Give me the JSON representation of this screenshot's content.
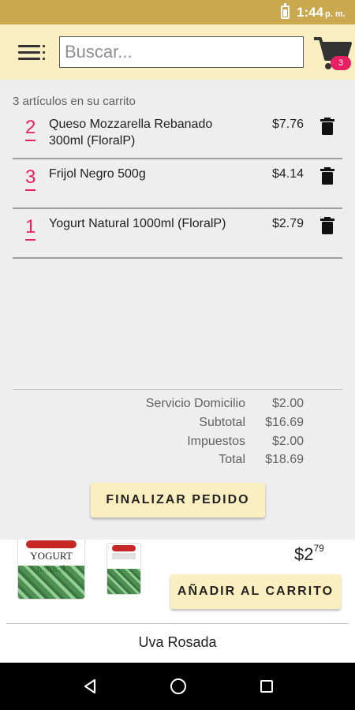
{
  "status_bar": {
    "time": "1:44",
    "ampm": "p. m."
  },
  "header": {
    "search_placeholder": "Buscar...",
    "cart_badge": "3"
  },
  "cart": {
    "count_text": "3 artículos en su carrito",
    "items": [
      {
        "qty": "2",
        "name": "Queso Mozzarella Rebanado 300ml (FloralP)",
        "price": "$7.76"
      },
      {
        "qty": "3",
        "name": "Frijol Negro 500g",
        "price": "$4.14"
      },
      {
        "qty": "1",
        "name": "Yogurt Natural 1000ml (FloralP)",
        "price": "$2.79"
      }
    ]
  },
  "summary": {
    "rows": [
      {
        "label": "Servicio Domicilio",
        "value": "$2.00"
      },
      {
        "label": "Subtotal",
        "value": "$16.69"
      },
      {
        "label": "Impuestos",
        "value": "$2.00"
      },
      {
        "label": "Total",
        "value": "$18.69"
      }
    ]
  },
  "checkout_label": "FINALIZAR PEDIDO",
  "product": {
    "image_text": "YOGURT natural",
    "price_main": "$2",
    "price_cents": "79",
    "add_label": "AÑADIR AL CARRITO",
    "next_name": "Uva Rosada"
  },
  "colors": {
    "status_bar": "#c9a84f",
    "app_bar": "#fbeec0",
    "accent_pink": "#e91e63",
    "panel_bg": "#eeeeee"
  },
  "icons": [
    "menu-icon",
    "cart-icon",
    "trash-icon",
    "back-icon",
    "home-icon",
    "recent-apps-icon"
  ]
}
